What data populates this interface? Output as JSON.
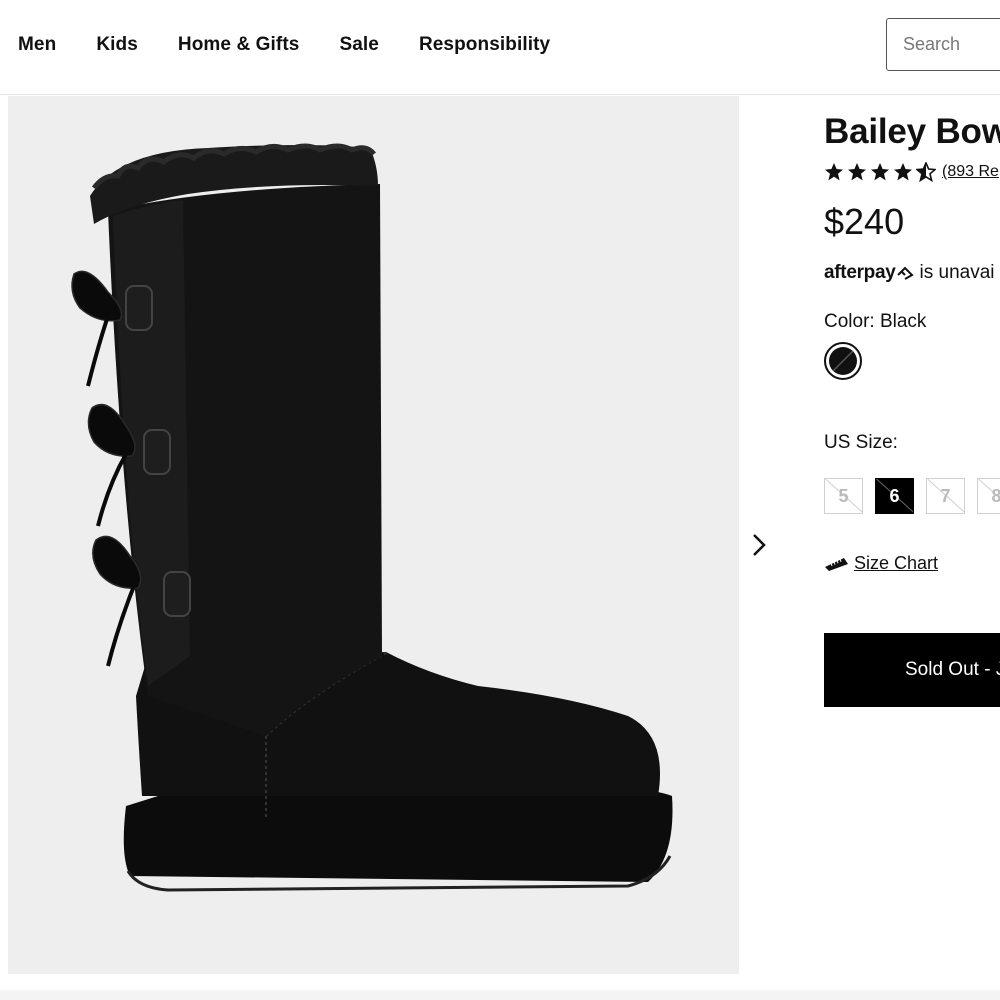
{
  "header": {
    "nav": [
      "Men",
      "Kids",
      "Home & Gifts",
      "Sale",
      "Responsibility"
    ],
    "search_placeholder": "Search"
  },
  "product": {
    "title": "Bailey Bow",
    "rating": 4.5,
    "reviews": "(893 Re",
    "price": "$240",
    "afterpay_logo": "afterpay",
    "afterpay_text": "is unavai",
    "color_label": "Color: Black",
    "size_label": "US Size:",
    "sizes": [
      {
        "label": "5",
        "available": false,
        "selected": false
      },
      {
        "label": "6",
        "available": false,
        "selected": true
      },
      {
        "label": "7",
        "available": false,
        "selected": false
      },
      {
        "label": "8",
        "available": false,
        "selected": false
      }
    ],
    "size_chart": "Size Chart",
    "sold_out": "Sold Out - J"
  },
  "colors": {
    "accent": "#000000",
    "gallery_bg": "#eeeeee"
  },
  "icons": [
    "star-icon",
    "half-star-icon",
    "afterpay-icon",
    "ruler-icon",
    "chevron-right-icon"
  ]
}
